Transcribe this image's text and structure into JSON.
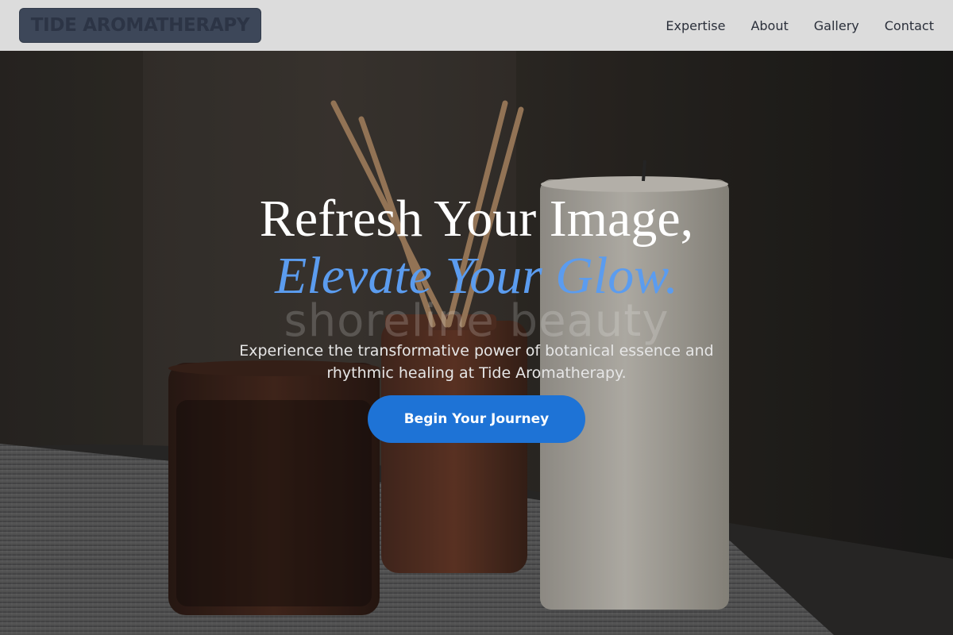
{
  "brand": {
    "name": "TIDE AROMATHERAPY"
  },
  "nav": {
    "items": [
      {
        "label": "Expertise"
      },
      {
        "label": "About"
      },
      {
        "label": "Gallery"
      },
      {
        "label": "Contact"
      }
    ]
  },
  "hero": {
    "headline_line1": "Refresh Your Image,",
    "headline_line2": "Elevate Your Glow.",
    "watermark": "shoreline beauty",
    "subtext": "Experience the transformative power of botanical essence and rhythmic healing at Tide Aromatherapy.",
    "cta_label": "Begin Your Journey",
    "image_name": "candle-and-diffuser-photo"
  },
  "colors": {
    "accent": "#5b9cef",
    "button": "#1e73d6",
    "header_bg": "#dcdcdc"
  }
}
